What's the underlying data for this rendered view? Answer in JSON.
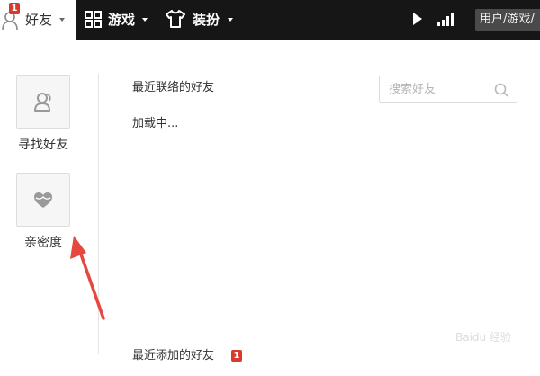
{
  "topbar": {
    "friends_tab": {
      "label": "好友",
      "badge": "1"
    },
    "games_tab": {
      "label": "游戏"
    },
    "dress_tab": {
      "label": "装扮"
    },
    "user_box": {
      "text": "用户/游戏/"
    }
  },
  "sidebar": {
    "find_friends": {
      "label": "寻找好友"
    },
    "intimacy": {
      "label": "亲密度"
    }
  },
  "main": {
    "recent_contacts_title": "最近联络的好友",
    "loading_text": "加载中...",
    "search": {
      "placeholder": "搜索好友",
      "value": ""
    },
    "recent_added_title": "最近添加的好友",
    "recent_added_badge": "1"
  },
  "watermark": "Baidu 经验",
  "colors": {
    "topbar_bg": "#161616",
    "badge_red": "#d83a2e",
    "arrow_red": "#e5483f",
    "card_bg": "#f6f6f6"
  },
  "icons": [
    "friends-icon",
    "grid-icon",
    "shirt-icon",
    "play-icon",
    "signal-icon",
    "person-icon",
    "heart-icon",
    "search-icon",
    "caret-down-icon"
  ]
}
